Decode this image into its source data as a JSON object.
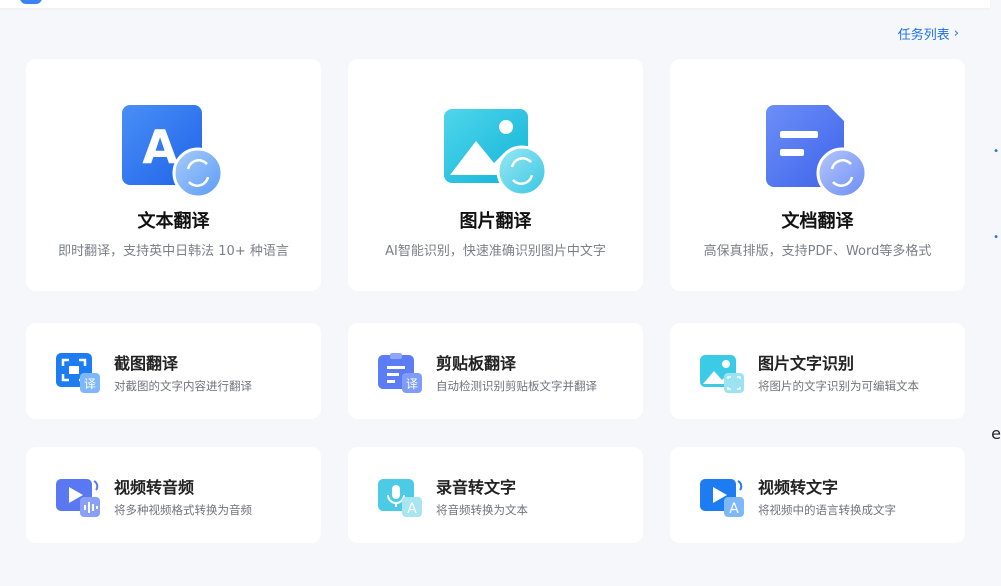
{
  "header": {
    "task_list_label": "任务列表",
    "task_list_chevron": "›"
  },
  "big_cards": [
    {
      "title": "文本翻译",
      "desc": "即时翻译，支持英中日韩法 10+ 种语言",
      "icon_letter": "A"
    },
    {
      "title": "图片翻译",
      "desc": "AI智能识别，快速准确识别图片中文字"
    },
    {
      "title": "文档翻译",
      "desc": "高保真排版，支持PDF、Word等多格式"
    }
  ],
  "small_cards": [
    {
      "title": "截图翻译",
      "desc": "对截图的文字内容进行翻译",
      "badge": "译"
    },
    {
      "title": "剪贴板翻译",
      "desc": "自动检测识别剪贴板文字并翻译",
      "badge": "译"
    },
    {
      "title": "图片文字识别",
      "desc": "将图片的文字识别为可编辑文本"
    },
    {
      "title": "视频转音频",
      "desc": "将多种视频格式转换为音频"
    },
    {
      "title": "录音转文字",
      "desc": "将音频转换为文本",
      "badge": "A"
    },
    {
      "title": "视频转文字",
      "desc": "将视频中的语言转换成文字",
      "badge": "A"
    }
  ],
  "edge_glyph": "e",
  "colors": {
    "accent": "#1e6ff5",
    "card_bg": "#ffffff",
    "page_bg": "#f5f7fa"
  }
}
